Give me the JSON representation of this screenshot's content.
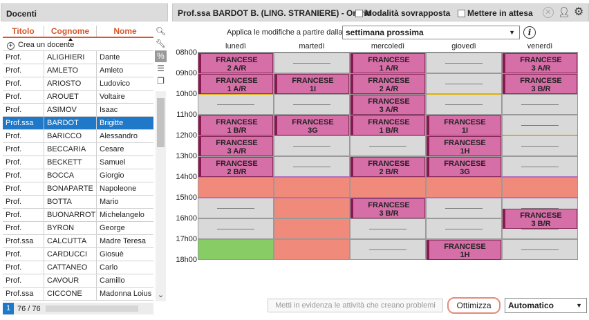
{
  "left": {
    "title": "Docenti",
    "columns": [
      "Titolo",
      "Cognome",
      "Nome"
    ],
    "create_label": "Crea un docente",
    "rows": [
      [
        "Prof.",
        "ALIGHIERI",
        "Dante"
      ],
      [
        "Prof.",
        "AMLETO",
        "Amleto"
      ],
      [
        "Prof.",
        "ARIOSTO",
        "Ludovico"
      ],
      [
        "Prof.",
        "AROUET",
        "Voltaire"
      ],
      [
        "Prof.",
        "ASIMOV",
        "Isaac"
      ],
      [
        "Prof.ssa",
        "BARDOT",
        "Brigitte"
      ],
      [
        "Prof.",
        "BARICCO",
        "Alessandro"
      ],
      [
        "Prof.",
        "BECCARIA",
        "Cesare"
      ],
      [
        "Prof.",
        "BECKETT",
        "Samuel"
      ],
      [
        "Prof.",
        "BOCCA",
        "Giorgio"
      ],
      [
        "Prof.",
        "BONAPARTE",
        "Napoleone"
      ],
      [
        "Prof.",
        "BOTTA",
        "Mario"
      ],
      [
        "Prof.",
        "BUONARROT",
        "Michelangelo"
      ],
      [
        "Prof.",
        "BYRON",
        "George"
      ],
      [
        "Prof.ssa",
        "CALCUTTA",
        "Madre Teresa"
      ],
      [
        "Prof.",
        "CARDUCCI",
        "Giosuè"
      ],
      [
        "Prof.",
        "CATTANEO",
        "Carlo"
      ],
      [
        "Prof.",
        "CAVOUR",
        "Camillo"
      ],
      [
        "Prof.ssa",
        "CICCONE",
        "Madonna Loius"
      ]
    ],
    "selected_index": 5,
    "page": "1",
    "count": "76 / 76"
  },
  "header": {
    "title": "Prof.ssa BARDOT B. (LING. STRANIERE)",
    "subtitle": "- Orario",
    "overlap_label": "Modalità sovrapposta",
    "wait_label": "Mettere in attesa"
  },
  "apply": {
    "label": "Applica le modifiche a partire dalla",
    "value": "settimana prossima"
  },
  "timetable": {
    "days": [
      "lunedì",
      "martedì",
      "mercoledì",
      "giovedì",
      "venerdì"
    ],
    "hours": [
      "08h00",
      "09h00",
      "10h00",
      "11h00",
      "12h00",
      "13h00",
      "14h00",
      "15h00",
      "16h00",
      "17h00",
      "18h00"
    ],
    "events": [
      {
        "day": 0,
        "start": 0,
        "dur": 1,
        "subject": "FRANCESE",
        "group": "2 A/R"
      },
      {
        "day": 0,
        "start": 1,
        "dur": 1,
        "subject": "FRANCESE",
        "group": "1 A/R"
      },
      {
        "day": 0,
        "start": 3,
        "dur": 1,
        "subject": "FRANCESE",
        "group": "1 B/R"
      },
      {
        "day": 0,
        "start": 4,
        "dur": 1,
        "subject": "FRANCESE",
        "group": "3 A/R"
      },
      {
        "day": 0,
        "start": 5,
        "dur": 1,
        "subject": "FRANCESE",
        "group": "2 B/R"
      },
      {
        "day": 1,
        "start": 1,
        "dur": 1,
        "subject": "FRANCESE",
        "group": "1I"
      },
      {
        "day": 1,
        "start": 3,
        "dur": 1,
        "subject": "FRANCESE",
        "group": "3G"
      },
      {
        "day": 2,
        "start": 0,
        "dur": 1,
        "subject": "FRANCESE",
        "group": "1 A/R"
      },
      {
        "day": 2,
        "start": 1,
        "dur": 1,
        "subject": "FRANCESE",
        "group": "2 A/R"
      },
      {
        "day": 2,
        "start": 2,
        "dur": 1,
        "subject": "FRANCESE",
        "group": "3 A/R"
      },
      {
        "day": 2,
        "start": 3,
        "dur": 1,
        "subject": "FRANCESE",
        "group": "1 B/R"
      },
      {
        "day": 2,
        "start": 5,
        "dur": 1,
        "subject": "FRANCESE",
        "group": "2 B/R"
      },
      {
        "day": 2,
        "start": 7,
        "dur": 1,
        "subject": "FRANCESE",
        "group": "3 B/R"
      },
      {
        "day": 3,
        "start": 3,
        "dur": 1,
        "subject": "FRANCESE",
        "group": "1I"
      },
      {
        "day": 3,
        "start": 4,
        "dur": 1,
        "subject": "FRANCESE",
        "group": "1H"
      },
      {
        "day": 3,
        "start": 5,
        "dur": 1,
        "subject": "FRANCESE",
        "group": "3G"
      },
      {
        "day": 3,
        "start": 9,
        "dur": 1,
        "subject": "FRANCESE",
        "group": "1H"
      },
      {
        "day": 4,
        "start": 0,
        "dur": 1,
        "subject": "FRANCESE",
        "group": "3 A/R"
      },
      {
        "day": 4,
        "start": 1,
        "dur": 1,
        "subject": "FRANCESE",
        "group": "3 B/R"
      },
      {
        "day": 4,
        "start": 7.5,
        "dur": 1,
        "subject": "FRANCESE",
        "group": "3 B/R"
      }
    ],
    "colors": {
      "event": "#d66ea8",
      "unavailable": "#f08a7a",
      "preferred": "#88cc66",
      "empty": "#d9d9d9"
    }
  },
  "bottom": {
    "highlight_label": "Metti in evidenza le attività che creano problemi",
    "optimize_label": "Ottimizza",
    "mode_value": "Automatico"
  }
}
